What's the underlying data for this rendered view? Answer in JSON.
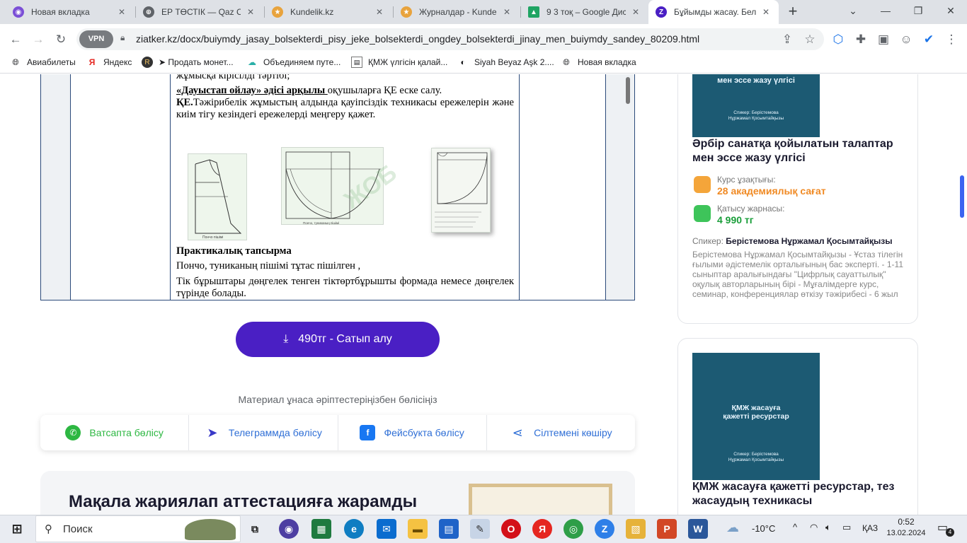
{
  "tabs": [
    {
      "title": "Новая вкладка",
      "icon": "chrome-icon",
      "color": "#7b4fd6"
    },
    {
      "title": "ЕР ТӨСТІК — Qaz Co",
      "icon": "globe-icon",
      "color": "#5f6368"
    },
    {
      "title": "Kundelik.kz",
      "icon": "kundelik-icon",
      "color": "#e8a33d"
    },
    {
      "title": "Журналдар - Kundeli",
      "icon": "kundelik-icon",
      "color": "#e8a33d"
    },
    {
      "title": "9 3 тоқ – Google Дис",
      "icon": "drive-icon",
      "color": "#1fa463"
    },
    {
      "title": "Бұйымды жасау. Бел",
      "icon": "ziatker-icon",
      "color": "#4a1fc4"
    }
  ],
  "address": {
    "vpn": "VPN",
    "url": "ziatker.kz/docx/buiymdy_jasay_bolsekterdi_pisy_jeke_bolsekterdi_ongdey_bolsekterdi_jinay_men_buiymdy_sandey_80209.html"
  },
  "bookmarks": [
    {
      "label": "Авиабилеты",
      "icon": "globe-icon"
    },
    {
      "label": "Яндекс",
      "icon": "yandex-icon"
    },
    {
      "label": "➤ Продать монет...",
      "icon": "r-icon"
    },
    {
      "label": "Объединяем путе...",
      "icon": "cloud-icon"
    },
    {
      "label": "ҚМЖ үлгісін қалай...",
      "icon": "doc-icon"
    },
    {
      "label": "Siyah Beyaz Aşk 2....",
      "icon": "globe-icon"
    },
    {
      "label": "Новая вкладка",
      "icon": "globe-icon"
    }
  ],
  "doc": {
    "line_top": "жұмысқа кірісілді тәртібі;",
    "method_label": "«Дауыстап ойлау» әдісі арқылы ",
    "method_rest": "оқушыларға ҚЕ еске салу.",
    "qe_label": "ҚЕ.",
    "qe_text": "Тәжірибелік жұмыстың алдында қауіпсіздік техникасы ережелерін және киім тігу кезіндегі ережелерді меңгеру қажет.",
    "practical_title": "Практикалық тапсырма",
    "practical_line1": "Пончо, туниканың пішімі тұтас пішілген ,",
    "practical_line2": "Тік бұрыштары дөңгелек тенген тіктөртбұрышты формада немесе дөңгелек түрінде болады.",
    "watermark": "ЖОБ"
  },
  "buy_button": {
    "label": "490тг - Сатып алу"
  },
  "share": {
    "title": "Материал ұнаса әріптестеріңізбен бөлісіңіз",
    "items": [
      {
        "label": "Ватсапта бөлісу",
        "icon": "whatsapp-icon",
        "color": "#2db742"
      },
      {
        "label": "Телеграммда бөлісу",
        "icon": "telegram-icon",
        "color": "#3a3ac8"
      },
      {
        "label": "Фейсбукта бөлісу",
        "icon": "facebook-icon",
        "color": "#1877f2"
      },
      {
        "label": "Сілтемені көшіру",
        "icon": "share-icon",
        "color": "#2f6fd6"
      }
    ]
  },
  "promo": {
    "title": "Мақала жариялап аттестацияға жарамды"
  },
  "card1": {
    "thumb_title": "мен эссе жазу үлгісі",
    "thumb_speaker_label": "Спикер: Берістемова",
    "thumb_speaker_name": "Нұржамал Қосымтайқызы",
    "title": "Әрбір санатқа қойылатын талаптар мен эссе жазу үлгісі",
    "duration_label": "Курс ұзақтығы:",
    "duration_value": "28 академиялық сағат",
    "fee_label": "Қатысу жарнасы:",
    "fee_value": "4 990 тг",
    "speaker_prefix": "Спикер: ",
    "speaker_name": "Берістемова Нұржамал Қосымтайқызы",
    "speaker_bio": "Берістемова Нұржамал Қосымтайқызы - Ұстаз тілегін ғылыми әдістемелік орталығының бас эксперті. - 1-11 сыныптар аралығындағы \"Цифрлық сауаттылық\" оқулық авторларының бірі - Мұғалімдерге курс, семинар, конференциялар өткізу тәжірибесі - 6 жыл"
  },
  "card2": {
    "thumb_title_1": "ҚМЖ жасауға",
    "thumb_title_2": "қажетті ресурстар",
    "thumb_speaker_label": "Спикер: Берістемова",
    "thumb_speaker_name": "Нұржамал Қосымтайқызы",
    "title": "ҚМЖ жасауға қажетті ресурстар, тез жасаудың техникасы"
  },
  "taskbar": {
    "search": "Поиск",
    "weather": "-10°C",
    "lang": "ҚАЗ",
    "time": "0:52",
    "date": "13.02.2024",
    "notif_count": "4"
  },
  "colors": {
    "accent": "#4a1fc4",
    "orange": "#f08a24",
    "green": "#1a9e3a"
  }
}
